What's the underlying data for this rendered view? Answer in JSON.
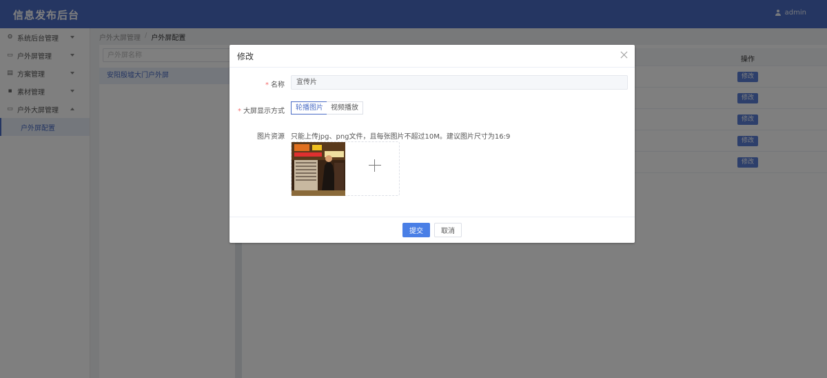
{
  "header": {
    "app_title": "信息发布后台",
    "username": "admin"
  },
  "sidebar": {
    "items": [
      {
        "label": "系统后台管理",
        "icon": "gear-icon"
      },
      {
        "label": "户外屏管理",
        "icon": "screen-icon"
      },
      {
        "label": "方案管理",
        "icon": "list-icon"
      },
      {
        "label": "素材管理",
        "icon": "file-icon"
      },
      {
        "label": "户外大屏管理",
        "icon": "screen-icon"
      }
    ],
    "subitem": "户外屏配置"
  },
  "breadcrumb": {
    "parent": "户外大屏管理",
    "separator": "/",
    "current": "户外屏配置"
  },
  "left_panel": {
    "search_placeholder": "户外屏名称",
    "tree_item": "安阳殷墟大门户外屏"
  },
  "table": {
    "ops_header": "操作",
    "edit_label": "修改",
    "rows": 5
  },
  "modal": {
    "title": "修改",
    "fields": {
      "name_label": "名称",
      "name_value": "宣传片",
      "display_label": "大屏显示方式",
      "display_options": [
        "轮播图片",
        "视频播放"
      ],
      "display_selected": "轮播图片",
      "resource_label": "图片资源",
      "resource_hint": "只能上传jpg、png文件，且每张图片不超过10M。建议图片尺寸为16:9"
    },
    "submit": "提交",
    "cancel": "取消"
  },
  "colors": {
    "primary": "#4a6cc5",
    "button": "#4a7fe6",
    "required": "#f56c6c"
  }
}
